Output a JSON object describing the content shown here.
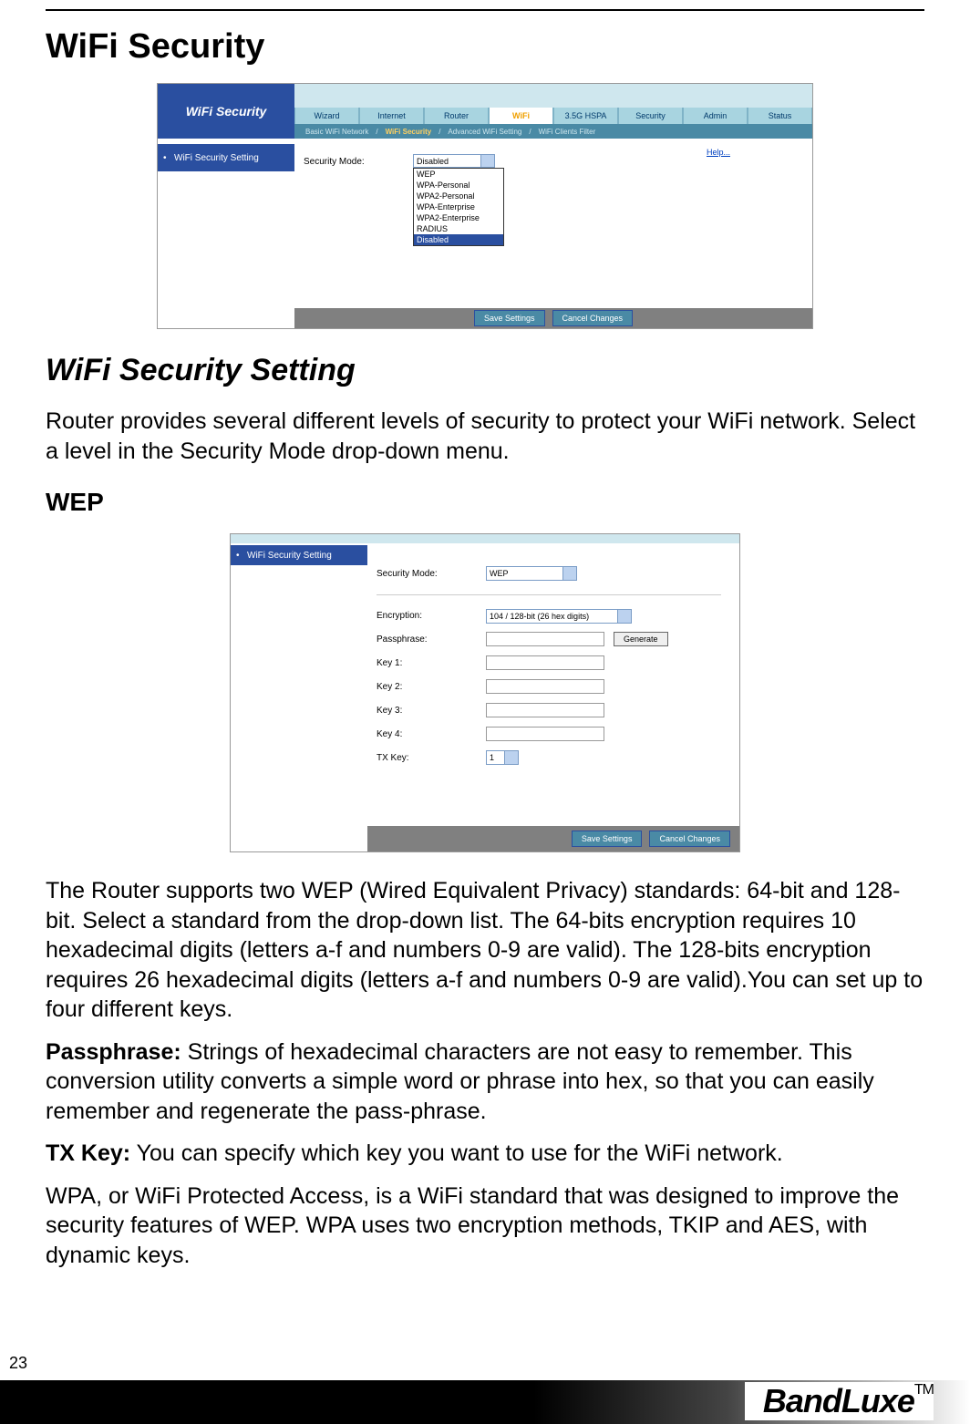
{
  "page": {
    "title": "WiFi Security",
    "section_title": "WiFi Security Setting",
    "intro": "Router provides several different levels of security to protect your WiFi network. Select a level in the Security Mode drop-down menu.",
    "wep_heading": "WEP",
    "wep_para": "The Router supports two WEP (Wired Equivalent Privacy) standards: 64-bit and 128-bit. Select a standard from the drop-down list. The 64-bits encryption requires 10 hexadecimal digits (letters a-f and numbers 0-9 are valid). The 128-bits encryption requires 26 hexadecimal digits (letters a-f and numbers 0-9 are valid).You can set up to four different keys.",
    "passphrase_label": "Passphrase:",
    "passphrase_text": " Strings of hexadecimal characters are not easy to remember. This conversion utility converts a simple word or phrase into hex, so that you can easily remember and regenerate the pass-phrase.",
    "txkey_label": "TX Key:",
    "txkey_text": " You can specify which key you want to use for the WiFi network.",
    "wpa_text": "WPA, or WiFi Protected Access, is a WiFi standard that was designed to improve the security features of WEP. WPA uses two encryption methods, TKIP and AES, with dynamic keys.",
    "page_number": "23",
    "brand": "BandLuxe",
    "tm": "TM"
  },
  "fig1": {
    "panel_title": "WiFi Security",
    "tabs": [
      "Wizard",
      "Internet",
      "Router",
      "WiFi",
      "3.5G HSPA",
      "Security",
      "Admin",
      "Status"
    ],
    "active_tab_index": 3,
    "subtabs": [
      "Basic WiFi Network",
      "WiFi Security",
      "Advanced WiFi Setting",
      "WiFi Clients Filter"
    ],
    "active_subtab_index": 1,
    "side_label": "WiFi Security Setting",
    "field_label": "Security Mode:",
    "selected": "Disabled",
    "options": [
      "WEP",
      "WPA-Personal",
      "WPA2-Personal",
      "WPA-Enterprise",
      "WPA2-Enterprise",
      "RADIUS",
      "Disabled"
    ],
    "help": "Help...",
    "save": "Save Settings",
    "cancel": "Cancel Changes"
  },
  "fig2": {
    "side_label": "WiFi Security Setting",
    "security_mode_label": "Security Mode:",
    "security_mode_value": "WEP",
    "encryption_label": "Encryption:",
    "encryption_value": "104 / 128-bit (26 hex digits)",
    "passphrase_label": "Passphrase:",
    "generate": "Generate",
    "key1": "Key 1:",
    "key2": "Key 2:",
    "key3": "Key 3:",
    "key4": "Key 4:",
    "txkey_label": "TX Key:",
    "txkey_value": "1",
    "save": "Save Settings",
    "cancel": "Cancel Changes"
  }
}
